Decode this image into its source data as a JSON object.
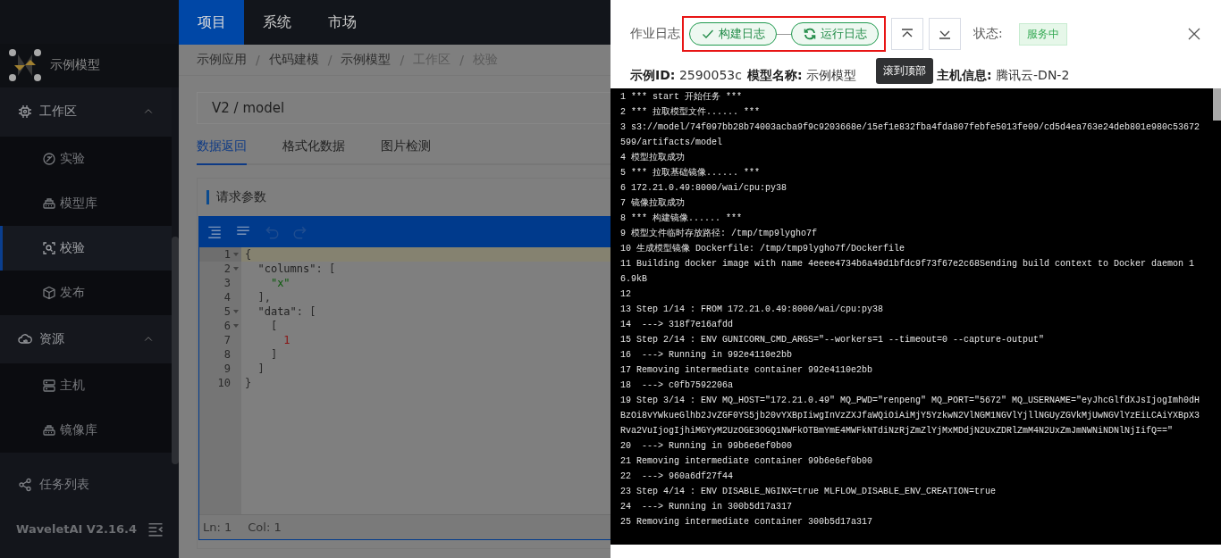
{
  "top_nav": {
    "tabs": [
      {
        "label": "项目",
        "selected": true
      },
      {
        "label": "系统",
        "selected": false
      },
      {
        "label": "市场",
        "selected": false
      }
    ]
  },
  "sidebar": {
    "project": "示例模型",
    "items": [
      {
        "label": "工作区",
        "expanded": true,
        "children": [
          {
            "label": "实验",
            "selected": false
          },
          {
            "label": "模型库",
            "selected": false
          },
          {
            "label": "校验",
            "selected": true
          },
          {
            "label": "发布",
            "selected": false
          }
        ]
      },
      {
        "label": "资源",
        "expanded": true,
        "children": [
          {
            "label": "主机",
            "selected": false
          },
          {
            "label": "镜像库",
            "selected": false
          }
        ]
      },
      {
        "label": "任务列表",
        "selected": false
      }
    ],
    "footer": "WaveletAI V2.16.4"
  },
  "breadcrumb": [
    {
      "text": "示例应用",
      "kind": "link"
    },
    {
      "text": "/",
      "kind": "separator"
    },
    {
      "text": "代码建模",
      "kind": "link"
    },
    {
      "text": "/",
      "kind": "separator"
    },
    {
      "text": "示例模型",
      "kind": "link"
    },
    {
      "text": "/",
      "kind": "separator"
    },
    {
      "text": "工作区",
      "kind": "current"
    },
    {
      "text": "/",
      "kind": "separator"
    },
    {
      "text": "校验",
      "kind": "current"
    }
  ],
  "model_field": {
    "value": "V2 / model"
  },
  "content_tabs": [
    {
      "label": "数据返回",
      "selected": true
    },
    {
      "label": "格式化数据",
      "selected": false
    },
    {
      "label": "图片检测",
      "selected": false
    }
  ],
  "request_card": {
    "title": "请求参数",
    "editor": {
      "lines": [
        {
          "number": "1",
          "text": "{",
          "foldable": true,
          "active": true
        },
        {
          "number": "2",
          "text": "  \"columns\": [",
          "foldable": true,
          "active": false
        },
        {
          "number": "3",
          "text": "    \"x\"",
          "foldable": false,
          "active": false
        },
        {
          "number": "4",
          "text": "  ],",
          "foldable": false,
          "active": false
        },
        {
          "number": "5",
          "text": "  \"data\": [",
          "foldable": true,
          "active": false
        },
        {
          "number": "6",
          "text": "    [",
          "foldable": true,
          "active": false
        },
        {
          "number": "7",
          "text": "      1",
          "foldable": false,
          "active": false
        },
        {
          "number": "8",
          "text": "    ]",
          "foldable": false,
          "active": false
        },
        {
          "number": "9",
          "text": "  ]",
          "foldable": false,
          "active": false
        },
        {
          "number": "10",
          "text": "}",
          "foldable": false,
          "active": false
        }
      ],
      "status": [
        "Ln: 1",
        "Col: 1"
      ]
    }
  },
  "drawer": {
    "title": "作业日志",
    "log_tabs": [
      {
        "label": "构建日志",
        "kind": "done"
      },
      {
        "label": "运行日志",
        "kind": "running"
      }
    ],
    "status_label": "状态:",
    "status": "服务中",
    "info": [
      {
        "label": "示例ID:",
        "value": "2590053c"
      },
      {
        "label": "模型名称:",
        "value": "示例模型"
      },
      {
        "label": "主机信息:",
        "value": "腾讯云-DN-2"
      }
    ],
    "tooltip": "滚到顶部",
    "log": [
      "1 *** start 开始任务 ***",
      "2 *** 拉取模型文件...... ***",
      "3 s3://model/74f097bb28b74003acba9f9c9203668e/15ef1e832fba4fda807febfe5013fe09/cd5d4ea763e24deb801e980c53672599/artifacts/model",
      "4 模型拉取成功",
      "5 *** 拉取基础镜像...... ***",
      "6 172.21.0.49:8000/wai/cpu:py38",
      "7 镜像拉取成功",
      "8 *** 构建镜像...... ***",
      "9 模型文件临时存放路径: /tmp/tmp9lygho7f",
      "10 生成模型镜像 Dockerfile: /tmp/tmp9lygho7f/Dockerfile",
      "11 Building docker image with name 4eeee4734b6a49d1bfdc9f73f67e2c68Sending build context to Docker daemon 16.9kB",
      "12",
      "13 Step 1/14 : FROM 172.21.0.49:8000/wai/cpu:py38",
      "14  ---> 318f7e16afdd",
      "15 Step 2/14 : ENV GUNICORN_CMD_ARGS=\"--workers=1 --timeout=0 --capture-output\"",
      "16  ---> Running in 992e4110e2bb",
      "17 Removing intermediate container 992e4110e2bb",
      "18  ---> c0fb7592206a",
      "19 Step 3/14 : ENV MQ_HOST=\"172.21.0.49\" MQ_PWD=\"renpeng\" MQ_PORT=\"5672\" MQ_USERNAME=\"eyJhcGlfdXJsIjogImh0dHBzOi8vYWkueGlhb2JvZGF0YS5jb20vYXBpIiwgInVzZXJfaWQiOiAiMjY5YzkwN2VlNGM1NGVlYjllNGUyZGVkMjUwNGVlYzEiLCAiYXBpX3Rva2VuIjogIjhiMGYyM2UzOGE3OGQ1NWFkOTBmYmE4MWFkNTdiNzRjZmZlYjMxMDdjN2UxZDRlZmM4N2UxZmJmNWNiNDNlNjIifQ==\"",
      "20  ---> Running in 99b6e6ef0b00",
      "21 Removing intermediate container 99b6e6ef0b00",
      "22  ---> 960a6df27f44",
      "23 Step 4/14 : ENV DISABLE_NGINX=true MLFLOW_DISABLE_ENV_CREATION=true",
      "24  ---> Running in 300b5d17a317",
      "25 Removing intermediate container 300b5d17a317"
    ]
  }
}
